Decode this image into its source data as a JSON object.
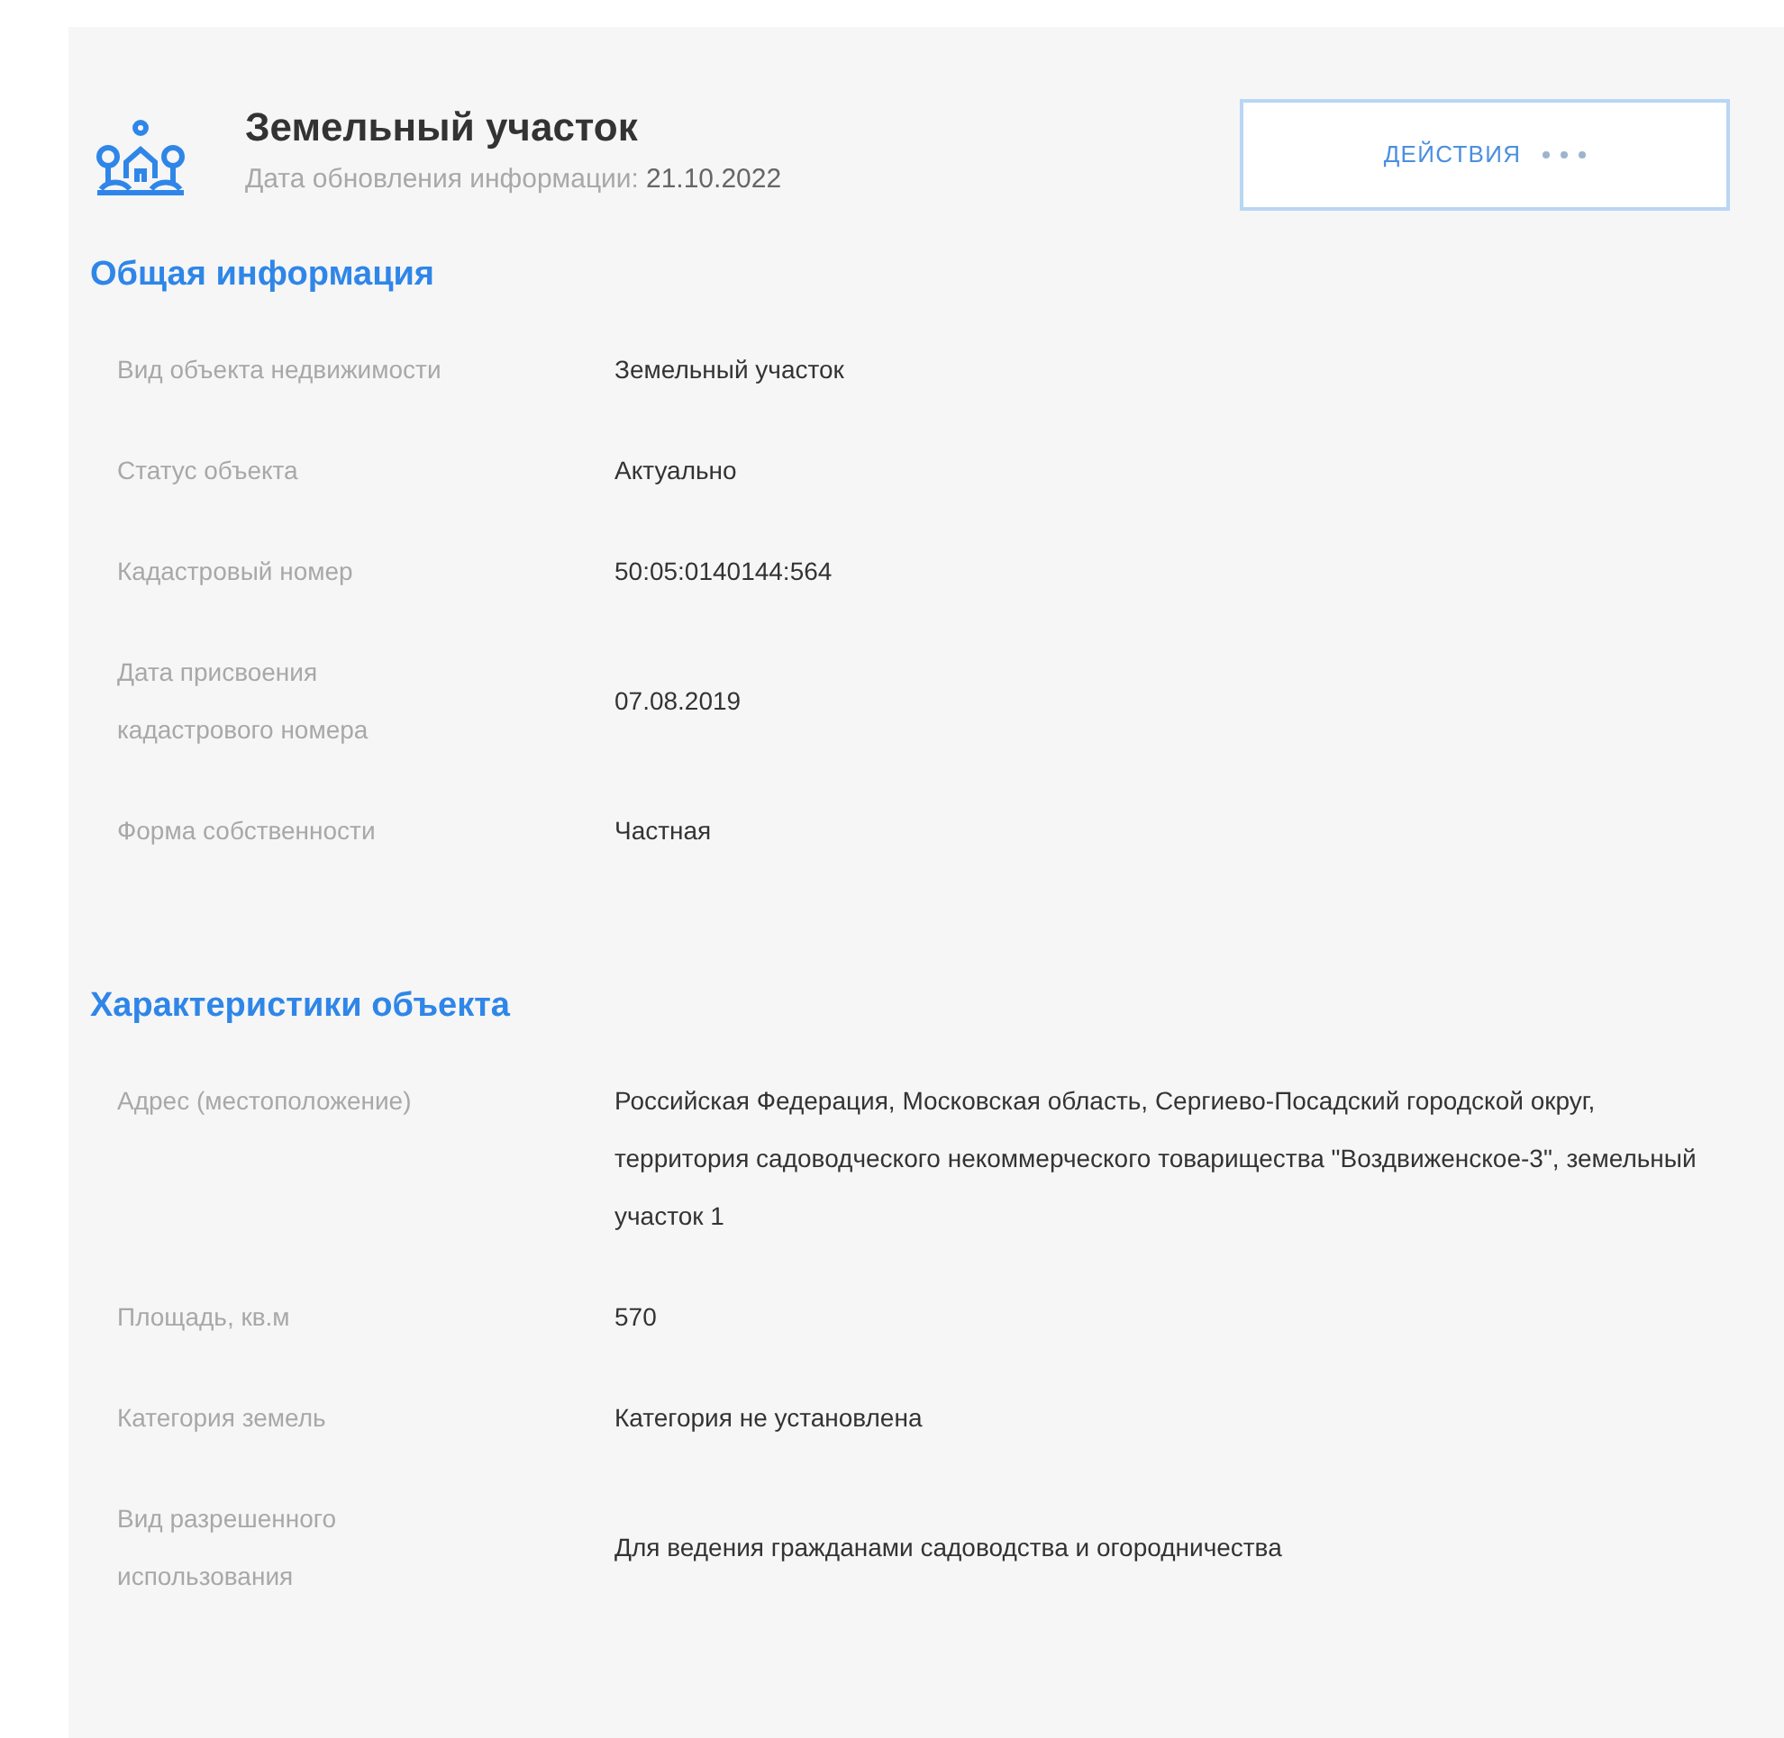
{
  "header": {
    "title": "Земельный участок",
    "update_label": "Дата обновления информации:",
    "update_date": "21.10.2022",
    "actions_button": "ДЕЙСТВИЯ"
  },
  "sections": [
    {
      "title": "Общая информация",
      "rows": [
        {
          "label": "Вид объекта недвижимости",
          "value": "Земельный участок"
        },
        {
          "label": "Статус объекта",
          "value": "Актуально"
        },
        {
          "label": "Кадастровый номер",
          "value": "50:05:0140144:564"
        },
        {
          "label": "Дата присвоения кадастрового номера",
          "value": "07.08.2019"
        },
        {
          "label": "Форма собственности",
          "value": "Частная"
        }
      ]
    },
    {
      "title": "Характеристики объекта",
      "rows": [
        {
          "label": "Адрес (местоположение)",
          "value": "Российская Федерация, Московская область, Сергиево-Посадский городской округ, территория садоводческого некоммерческого товарищества \"Воздвиженское-3\", земельный участок 1"
        },
        {
          "label": "Площадь, кв.м",
          "value": "570"
        },
        {
          "label": "Категория земель",
          "value": "Категория не установлена"
        },
        {
          "label": "Вид разрешенного использования",
          "value": "Для ведения гражданами садоводства и огородничества"
        }
      ]
    }
  ]
}
